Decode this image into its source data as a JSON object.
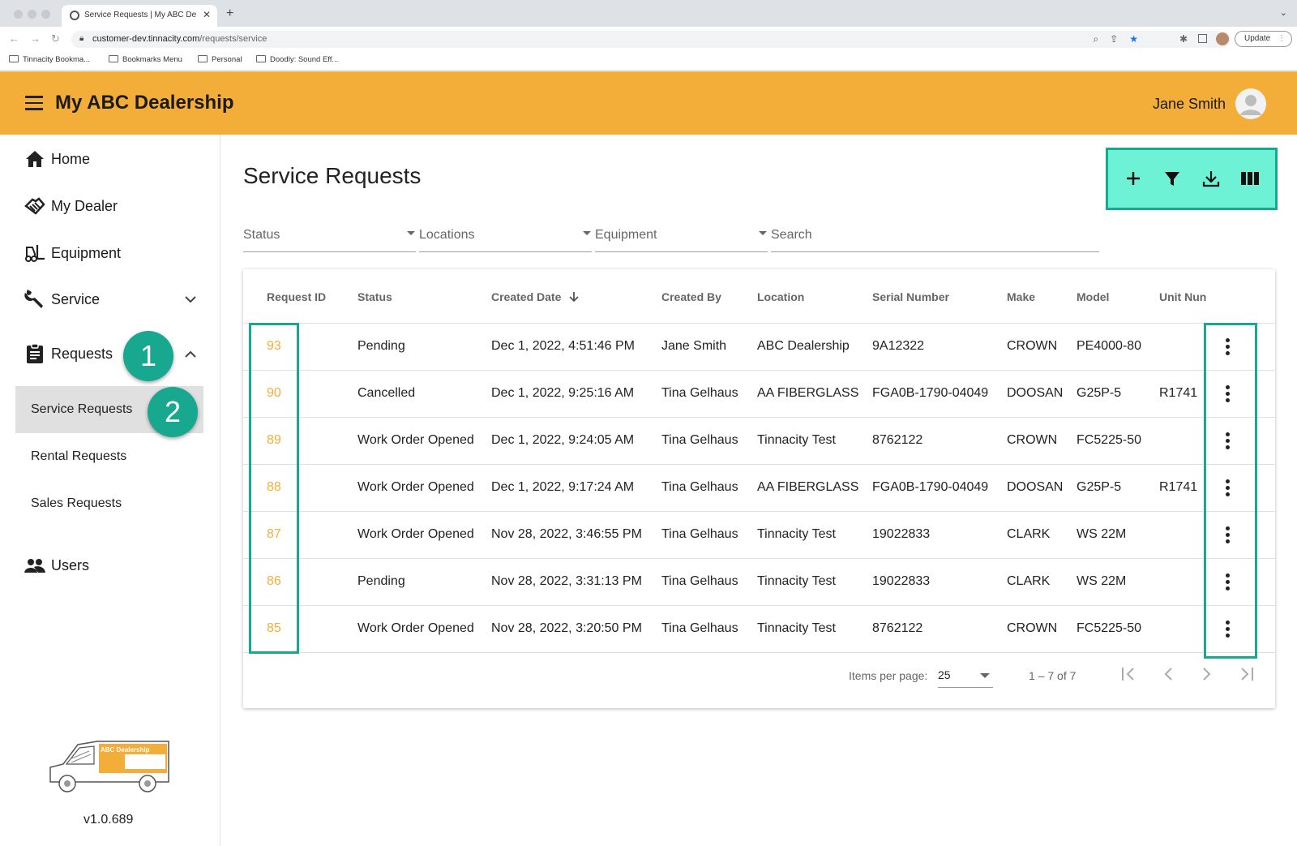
{
  "browser": {
    "tab_title": "Service Requests | My ABC De",
    "url_host": "customer-dev.tinnacity.com",
    "url_path": "/requests/service",
    "update_label": "Update",
    "bookmarks": [
      "Tinnacity Bookma...",
      "Bookmarks Menu",
      "Personal",
      "Doodly: Sound Eff..."
    ]
  },
  "header": {
    "title": "My ABC Dealership",
    "user_name": "Jane Smith"
  },
  "sidebar": {
    "items": [
      {
        "label": "Home",
        "icon": "home-icon"
      },
      {
        "label": "My Dealer",
        "icon": "handshake-icon"
      },
      {
        "label": "Equipment",
        "icon": "forklift-icon"
      },
      {
        "label": "Service",
        "icon": "wrench-icon"
      },
      {
        "label": "Requests",
        "icon": "clipboard-icon"
      },
      {
        "label": "Users",
        "icon": "users-icon"
      }
    ],
    "sub_items": [
      "Service Requests",
      "Rental Requests",
      "Sales Requests"
    ],
    "badges": [
      "1",
      "2"
    ],
    "logo_text": "ABC Dealership",
    "version": "v1.0.689"
  },
  "main": {
    "title": "Service Requests",
    "filters": {
      "status": "Status",
      "locations": "Locations",
      "equipment": "Equipment",
      "search": "Search"
    },
    "columns": [
      "Request ID",
      "Status",
      "Created Date",
      "Created By",
      "Location",
      "Serial Number",
      "Make",
      "Model",
      "Unit Nun"
    ],
    "rows": [
      {
        "id": "93",
        "status": "Pending",
        "created": "Dec 1, 2022, 4:51:46 PM",
        "by": "Jane Smith",
        "location": "ABC Dealership",
        "serial": "9A12322",
        "make": "CROWN",
        "model": "PE4000-80",
        "unit": ""
      },
      {
        "id": "90",
        "status": "Cancelled",
        "created": "Dec 1, 2022, 9:25:16 AM",
        "by": "Tina Gelhaus",
        "location": "AA FIBERGLASS",
        "serial": "FGA0B-1790-04049",
        "make": "DOOSAN",
        "model": "G25P-5",
        "unit": "R1741"
      },
      {
        "id": "89",
        "status": "Work Order Opened",
        "created": "Dec 1, 2022, 9:24:05 AM",
        "by": "Tina Gelhaus",
        "location": "Tinnacity Test",
        "serial": "8762122",
        "make": "CROWN",
        "model": "FC5225-50",
        "unit": ""
      },
      {
        "id": "88",
        "status": "Work Order Opened",
        "created": "Dec 1, 2022, 9:17:24 AM",
        "by": "Tina Gelhaus",
        "location": "AA FIBERGLASS",
        "serial": "FGA0B-1790-04049",
        "make": "DOOSAN",
        "model": "G25P-5",
        "unit": "R1741"
      },
      {
        "id": "87",
        "status": "Work Order Opened",
        "created": "Nov 28, 2022, 3:46:55 PM",
        "by": "Tina Gelhaus",
        "location": "Tinnacity Test",
        "serial": "19022833",
        "make": "CLARK",
        "model": "WS 22M",
        "unit": ""
      },
      {
        "id": "86",
        "status": "Pending",
        "created": "Nov 28, 2022, 3:31:13 PM",
        "by": "Tina Gelhaus",
        "location": "Tinnacity Test",
        "serial": "19022833",
        "make": "CLARK",
        "model": "WS 22M",
        "unit": ""
      },
      {
        "id": "85",
        "status": "Work Order Opened",
        "created": "Nov 28, 2022, 3:20:50 PM",
        "by": "Tina Gelhaus",
        "location": "Tinnacity Test",
        "serial": "8762122",
        "make": "CROWN",
        "model": "FC5225-50",
        "unit": ""
      }
    ],
    "paginator": {
      "items_per_page_label": "Items per page:",
      "page_size": "25",
      "range": "1 – 7 of 7"
    }
  },
  "colors": {
    "header_bg": "#f3ae39",
    "accent_id": "#f3ae39",
    "highlight": "#17a88f",
    "toolbar_bg": "#6ef2d5"
  }
}
